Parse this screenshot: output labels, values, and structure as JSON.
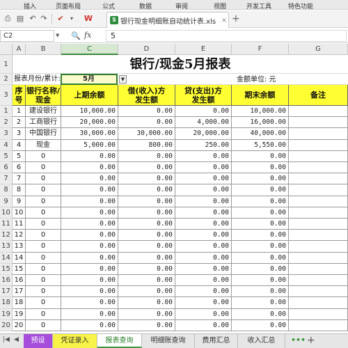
{
  "menu": [
    "插入",
    "页面布局",
    "公式",
    "数据",
    "审阅",
    "视图",
    "开发工具",
    "特色功能"
  ],
  "file_tab": {
    "name": "银行现金明细账自动统计表.xls",
    "close": "×",
    "new": "+"
  },
  "toolbar_icons": [
    "print-icon",
    "preview-icon",
    "undo-icon",
    "redo-icon",
    "format-painter-icon",
    "wps-icon"
  ],
  "formula_bar": {
    "cell_ref": "C2",
    "fx": "fx",
    "value": "5"
  },
  "columns": [
    "A",
    "B",
    "C",
    "D",
    "E",
    "F",
    "G"
  ],
  "selected_column": "C",
  "sheet": {
    "title": "银行/现金5月报表",
    "report_label": "报表月份/累计:",
    "report_month": "5月",
    "unit_label": "金额单位: 元",
    "headers": [
      "序号",
      "银行名称/现金",
      "上期余额",
      "借(收入)方发生额",
      "贷(支出)方发生额",
      "期末余额",
      "备注"
    ],
    "header_lines": [
      [
        "序",
        "号"
      ],
      [
        "银行名称/",
        "现金"
      ],
      [
        "上期余额"
      ],
      [
        "借(收入)方",
        "发生额"
      ],
      [
        "贷(支出)方",
        "发生额"
      ],
      [
        "期末余额"
      ],
      [
        "备注"
      ]
    ],
    "rows": [
      [
        "1",
        "建设银行",
        "10,000.00",
        "0.00",
        "0.00",
        "10,000.00",
        ""
      ],
      [
        "2",
        "工商银行",
        "20,000.00",
        "0.00",
        "4,000.00",
        "16,000.00",
        ""
      ],
      [
        "3",
        "中国银行",
        "30,000.00",
        "30,000.00",
        "20,000.00",
        "40,000.00",
        ""
      ],
      [
        "4",
        "现金",
        "5,000.00",
        "800.00",
        "250.00",
        "5,550.00",
        ""
      ],
      [
        "5",
        "0",
        "0.00",
        "0.00",
        "0.00",
        "0.00",
        ""
      ],
      [
        "6",
        "0",
        "0.00",
        "0.00",
        "0.00",
        "0.00",
        ""
      ],
      [
        "7",
        "0",
        "0.00",
        "0.00",
        "0.00",
        "0.00",
        ""
      ],
      [
        "8",
        "0",
        "0.00",
        "0.00",
        "0.00",
        "0.00",
        ""
      ],
      [
        "9",
        "0",
        "0.00",
        "0.00",
        "0.00",
        "0.00",
        ""
      ],
      [
        "10",
        "0",
        "0.00",
        "0.00",
        "0.00",
        "0.00",
        ""
      ],
      [
        "11",
        "0",
        "0.00",
        "0.00",
        "0.00",
        "0.00",
        ""
      ],
      [
        "12",
        "0",
        "0.00",
        "0.00",
        "0.00",
        "0.00",
        ""
      ],
      [
        "13",
        "0",
        "0.00",
        "0.00",
        "0.00",
        "0.00",
        ""
      ],
      [
        "14",
        "0",
        "0.00",
        "0.00",
        "0.00",
        "0.00",
        ""
      ],
      [
        "15",
        "0",
        "0.00",
        "0.00",
        "0.00",
        "0.00",
        ""
      ],
      [
        "16",
        "0",
        "0.00",
        "0.00",
        "0.00",
        "0.00",
        ""
      ],
      [
        "17",
        "0",
        "0.00",
        "0.00",
        "0.00",
        "0.00",
        ""
      ],
      [
        "18",
        "0",
        "0.00",
        "0.00",
        "0.00",
        "0.00",
        ""
      ],
      [
        "19",
        "0",
        "0.00",
        "0.00",
        "0.00",
        "0.00",
        ""
      ],
      [
        "20",
        "0",
        "0.00",
        "0.00",
        "0.00",
        "0.00",
        ""
      ]
    ],
    "row_numbers_top": [
      "1",
      "2",
      "3"
    ]
  },
  "sheet_tabs": [
    {
      "label": "预设",
      "style": "purple"
    },
    {
      "label": "凭证录入",
      "style": "yellow"
    },
    {
      "label": "报表查询",
      "style": "active"
    },
    {
      "label": "明细账查询",
      "style": "plain"
    },
    {
      "label": "费用汇总",
      "style": "plain"
    },
    {
      "label": "收入汇总",
      "style": "plain"
    }
  ],
  "sheet_more": "•••",
  "sheet_add": "+",
  "colors": {
    "header_fill": "#ffff33",
    "active_tab": "#3a9a3a",
    "preset_tab": "#a64ddb",
    "voucher_tab": "#f7f348"
  }
}
